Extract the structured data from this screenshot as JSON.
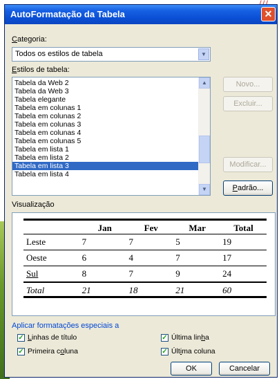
{
  "window": {
    "title": "AutoFormatação da Tabela"
  },
  "categoria": {
    "label_pre": "C",
    "label_mid": "ategoria:",
    "selected": "Todos os estilos de tabela"
  },
  "estilos": {
    "label_pre": "E",
    "label_mid": "stilos de tabela:",
    "items": [
      "Tabela da Web 2",
      "Tabela da Web 3",
      "Tabela elegante",
      "Tabela em colunas 1",
      "Tabela em colunas 2",
      "Tabela em colunas 3",
      "Tabela em colunas 4",
      "Tabela em colunas 5",
      "Tabela em lista 1",
      "Tabela em lista 2",
      "Tabela em lista 3",
      "Tabela em lista 4"
    ],
    "selected_index": 10
  },
  "side_buttons": {
    "novo": "Novo...",
    "excluir": "Excluir...",
    "modificar": "Modificar...",
    "padrao_pre": "P",
    "padrao_rest": "adrão..."
  },
  "preview": {
    "label": "Visualização",
    "headers": [
      "",
      "Jan",
      "Fev",
      "Mar",
      "Total"
    ],
    "rows": [
      [
        "Leste",
        "7",
        "7",
        "5",
        "19"
      ],
      [
        "Oeste",
        "6",
        "4",
        "7",
        "17"
      ],
      [
        "Sul",
        "8",
        "7",
        "9",
        "24"
      ],
      [
        "Total",
        "21",
        "18",
        "21",
        "60"
      ]
    ]
  },
  "special": {
    "label": "Aplicar formatações especiais a",
    "linhas_titulo": {
      "pre": "L",
      "rest": "inhas de título",
      "checked": true
    },
    "primeira_coluna": {
      "pre": "Primeira c",
      "mid": "o",
      "rest": "luna",
      "checked": true
    },
    "ultima_linha": {
      "pre": "Última lin",
      "mid": "h",
      "rest": "a",
      "checked": true
    },
    "ultima_coluna": {
      "pre": "Últ",
      "mid": "i",
      "rest": "ma coluna",
      "checked": true
    }
  },
  "footer": {
    "ok": "OK",
    "cancel": "Cancelar"
  },
  "accent": {
    "titlebar": "#0a4fd4",
    "selection": "#316ac5",
    "close": "#e0502c"
  }
}
